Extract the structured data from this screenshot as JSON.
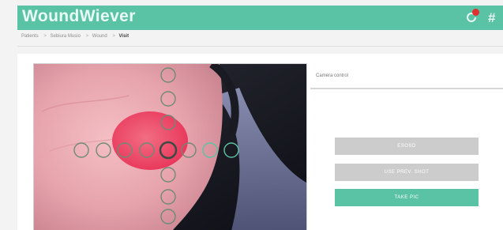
{
  "header": {
    "app_title": "WoundWiever",
    "sync_icon": "sync-icon",
    "notification_badge_color": "#e02f2f",
    "menu_icon": "grid-icon",
    "menu_glyph": "#",
    "accent_color": "#5bc3a5"
  },
  "breadcrumb": {
    "items": [
      "Patients",
      "Sebiura Musio",
      "Wound",
      "Visit"
    ],
    "separator": ">"
  },
  "camera": {
    "label": "Camera control",
    "buttons": {
      "first": "ESOSD",
      "second": "USE PREV. SHOT",
      "take": "TAKE PIC"
    }
  },
  "preview": {
    "guide_rings": {
      "horizontal_count": 7,
      "vertical_count": 8
    }
  }
}
